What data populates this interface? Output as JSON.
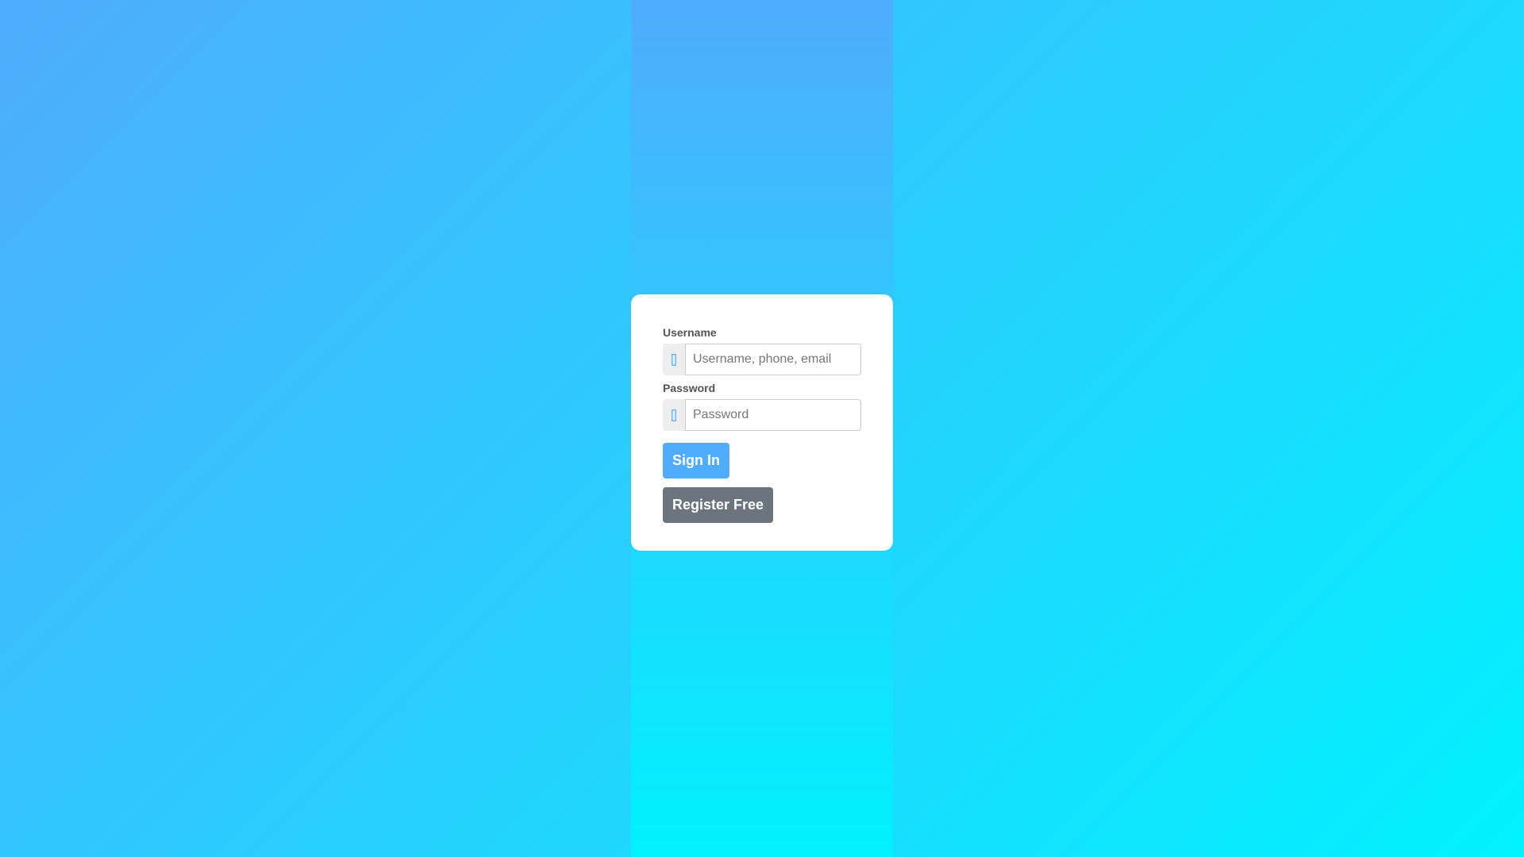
{
  "login": {
    "username_label": "Username",
    "username_placeholder": "Username, phone, email",
    "password_label": "Password",
    "password_placeholder": "Password",
    "sign_in_label": "Sign In",
    "register_label": "Register Free"
  },
  "icons": {
    "username_icon": "user-icon",
    "password_icon": "lock-icon"
  },
  "colors": {
    "gradient_start": "#4facfe",
    "gradient_end": "#00f2fe",
    "primary_button": "#4facfe",
    "secondary_button": "#6c757d"
  }
}
